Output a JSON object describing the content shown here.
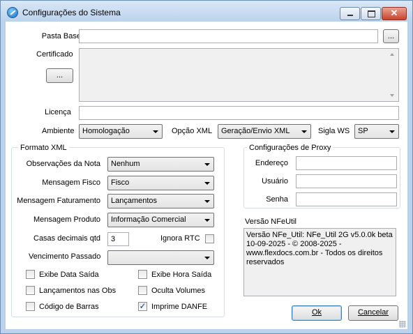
{
  "window": {
    "title": "Configurações do Sistema",
    "icon": "tools-icon",
    "controls": [
      "minimize",
      "maximize",
      "close"
    ]
  },
  "form": {
    "pasta_base": {
      "label": "Pasta Base",
      "value": "",
      "browse_label": "..."
    },
    "certificado": {
      "label": "Certificado",
      "value": "",
      "browse_label": "..."
    },
    "licenca": {
      "label": "Licença",
      "value": ""
    },
    "ambiente": {
      "label": "Ambiente",
      "value": "Homologação"
    },
    "opcao_xml": {
      "label": "Opção XML",
      "value": "Geração/Envio XML"
    },
    "sigla_ws": {
      "label": "Sigla WS",
      "value": "SP"
    }
  },
  "formato_xml": {
    "title": "Formato XML",
    "observacoes": {
      "label": "Observações da Nota",
      "value": "Nenhum"
    },
    "mensagem_fisco": {
      "label": "Mensagem Fisco",
      "value": "Fisco"
    },
    "mensagem_faturamento": {
      "label": "Mensagem Faturamento",
      "value": "Lançamentos"
    },
    "mensagem_produto": {
      "label": "Mensagem Produto",
      "value": "Informação Comercial"
    },
    "casas_decimais": {
      "label": "Casas decimais qtd",
      "value": "3"
    },
    "ignora_rtc": {
      "label": "Ignora RTC",
      "checked": false
    },
    "vencimento_passado": {
      "label": "Vencimento Passado",
      "value": ""
    },
    "checkboxes": [
      {
        "label": "Exibe Data Saída",
        "checked": false
      },
      {
        "label": "Exibe Hora Saída",
        "checked": false
      },
      {
        "label": "Lançamentos nas Obs",
        "checked": false
      },
      {
        "label": "Oculta Volumes",
        "checked": false
      },
      {
        "label": "Código de Barras",
        "checked": false
      },
      {
        "label": "Imprime DANFE",
        "checked": true
      }
    ]
  },
  "proxy": {
    "title": "Configurações de Proxy",
    "endereco": {
      "label": "Endereço",
      "value": ""
    },
    "usuario": {
      "label": "Usuário",
      "value": ""
    },
    "senha": {
      "label": "Senha",
      "value": ""
    }
  },
  "versao": {
    "title": "Versão NFeUtil",
    "text": "Versão NFe_Util: NFe_Util 2G v5.0.0k beta 10-09-2025 - © 2008-2025 - www.flexdocs.com.br - Todos os direitos reservados"
  },
  "buttons": {
    "ok": "Ok",
    "cancelar": "Cancelar"
  }
}
